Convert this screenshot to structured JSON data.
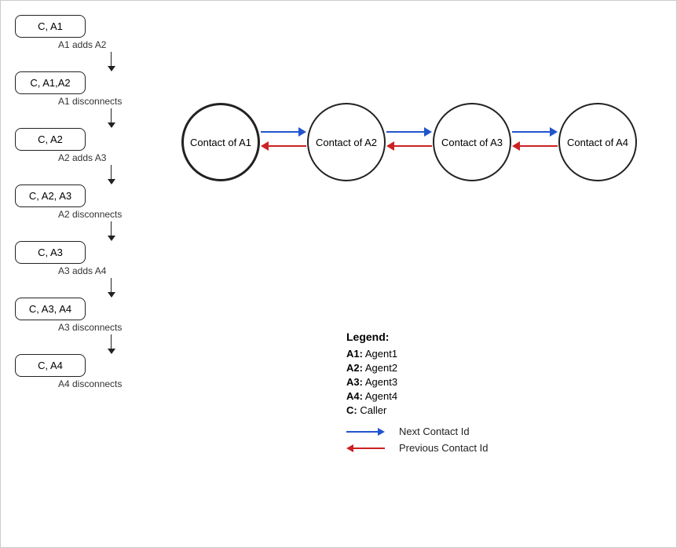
{
  "flowchart": {
    "nodes": [
      {
        "id": "n1",
        "label": "C, A1"
      },
      {
        "id": "n2",
        "label": "C, A1,A2"
      },
      {
        "id": "n3",
        "label": "C, A2"
      },
      {
        "id": "n4",
        "label": "C, A2, A3"
      },
      {
        "id": "n5",
        "label": "C, A3"
      },
      {
        "id": "n6",
        "label": "C, A3, A4"
      },
      {
        "id": "n7",
        "label": "C, A4"
      }
    ],
    "transitions": [
      {
        "id": "t1",
        "label": "A1 adds A2"
      },
      {
        "id": "t2",
        "label": "A1 disconnects"
      },
      {
        "id": "t3",
        "label": "A2 adds A3"
      },
      {
        "id": "t4",
        "label": "A2 disconnects"
      },
      {
        "id": "t5",
        "label": "A3 adds A4"
      },
      {
        "id": "t6",
        "label": "A3 disconnects"
      },
      {
        "id": "t7",
        "label": "A4 disconnects"
      }
    ]
  },
  "diagram": {
    "circles": [
      {
        "id": "c1",
        "label": "Contact of A1",
        "bold": true
      },
      {
        "id": "c2",
        "label": "Contact of A2",
        "bold": false
      },
      {
        "id": "c3",
        "label": "Contact of A3",
        "bold": false
      },
      {
        "id": "c4",
        "label": "Contact of A4",
        "bold": false
      }
    ]
  },
  "legend": {
    "title": "Legend:",
    "items": [
      {
        "key": "A1:",
        "value": "Agent1"
      },
      {
        "key": "A2:",
        "value": "Agent2"
      },
      {
        "key": "A3:",
        "value": "Agent3"
      },
      {
        "key": "A4:",
        "value": "Agent4"
      },
      {
        "key": "C:",
        "value": "Caller"
      }
    ],
    "arrows": [
      {
        "color": "blue",
        "label": "Next Contact Id"
      },
      {
        "color": "red",
        "label": "Previous Contact Id"
      }
    ]
  }
}
